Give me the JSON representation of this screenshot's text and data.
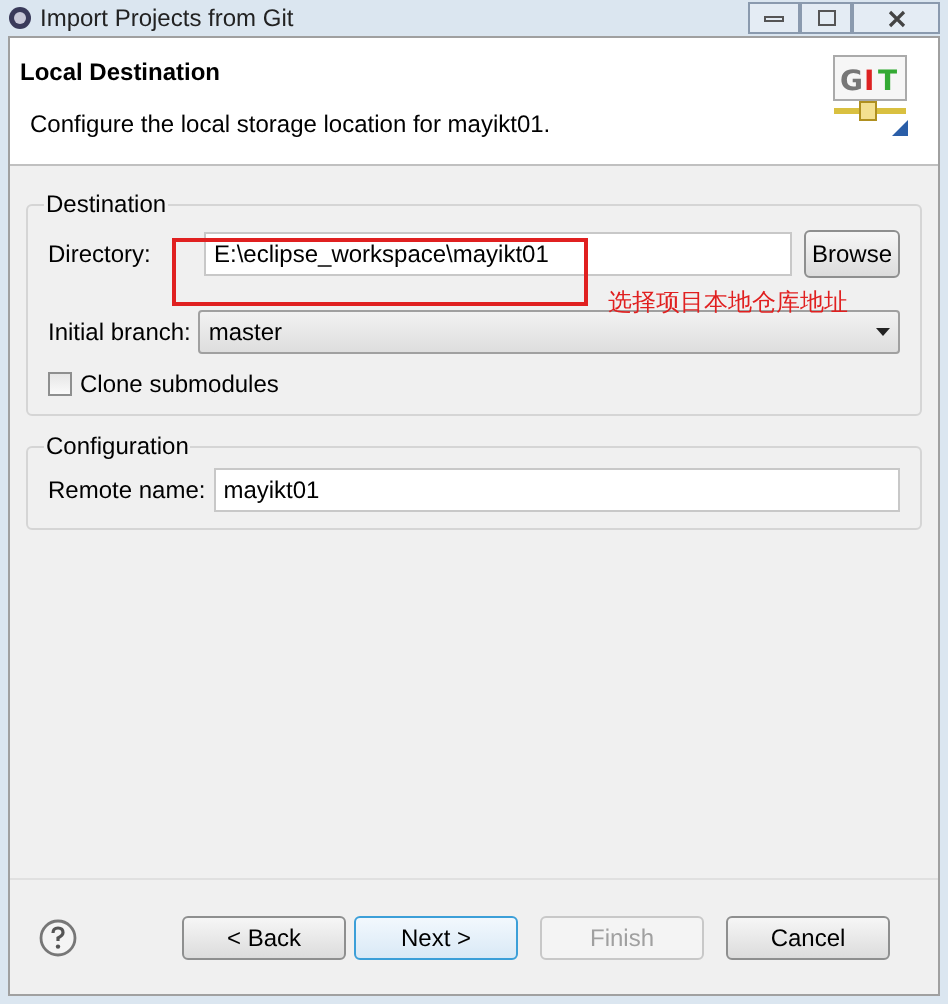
{
  "window": {
    "title": "Import Projects from Git"
  },
  "header": {
    "logo_letters": [
      "G",
      "I",
      "T"
    ],
    "title": "Local Destination",
    "description": "Configure the local storage location for mayikt01."
  },
  "destination": {
    "legend": "Destination",
    "directory_label": "Directory:",
    "directory_value": "E:\\eclipse_workspace\\mayikt01",
    "browse": "Browse",
    "branch_label": "Initial branch:",
    "branch_value": "master",
    "clone_submodules": {
      "label": "Clone submodules",
      "checked": false
    }
  },
  "configuration": {
    "legend": "Configuration",
    "remote_label": "Remote name:",
    "remote_value": "mayikt01"
  },
  "annotation": {
    "text": "选择项目本地仓库地址"
  },
  "buttons": [
    {
      "label": "< Back",
      "disabled": false,
      "default": false
    },
    {
      "label": "Next >",
      "disabled": false,
      "default": true
    },
    {
      "label": "Finish",
      "disabled": true,
      "default": false
    },
    {
      "label": "Cancel",
      "disabled": false,
      "default": false
    }
  ]
}
